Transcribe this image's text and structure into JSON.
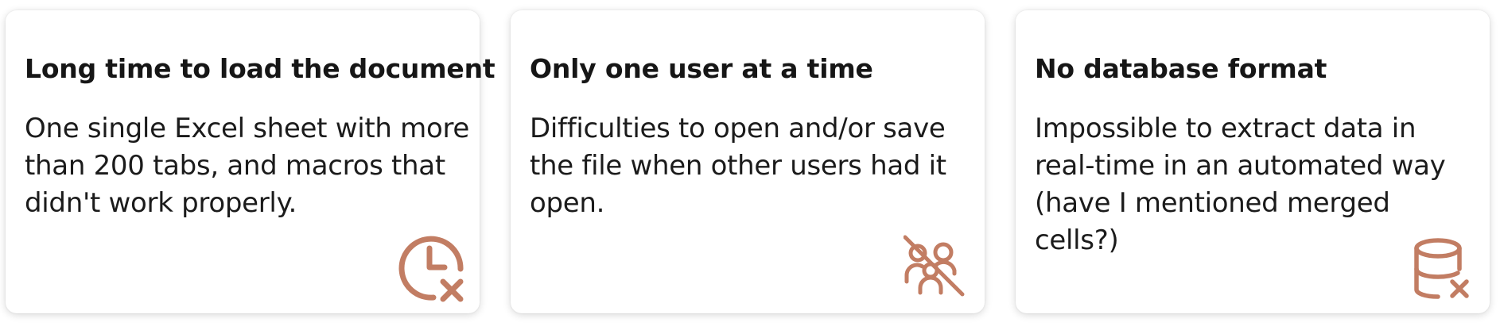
{
  "accent_color": "#c27d63",
  "cards": [
    {
      "title": "Long time to load the document",
      "body": "One single Excel sheet with more than 200 tabs, and macros that didn't work properly.",
      "icon": "clock-x-icon"
    },
    {
      "title": "Only one user at a time",
      "body": "Difficulties to open and/or save the file when other users had it open.",
      "icon": "users-off-icon"
    },
    {
      "title": "No database format",
      "body": "Impossible to extract data in real-time in an automated way (have I mentioned merged cells?)",
      "icon": "database-x-icon"
    }
  ]
}
